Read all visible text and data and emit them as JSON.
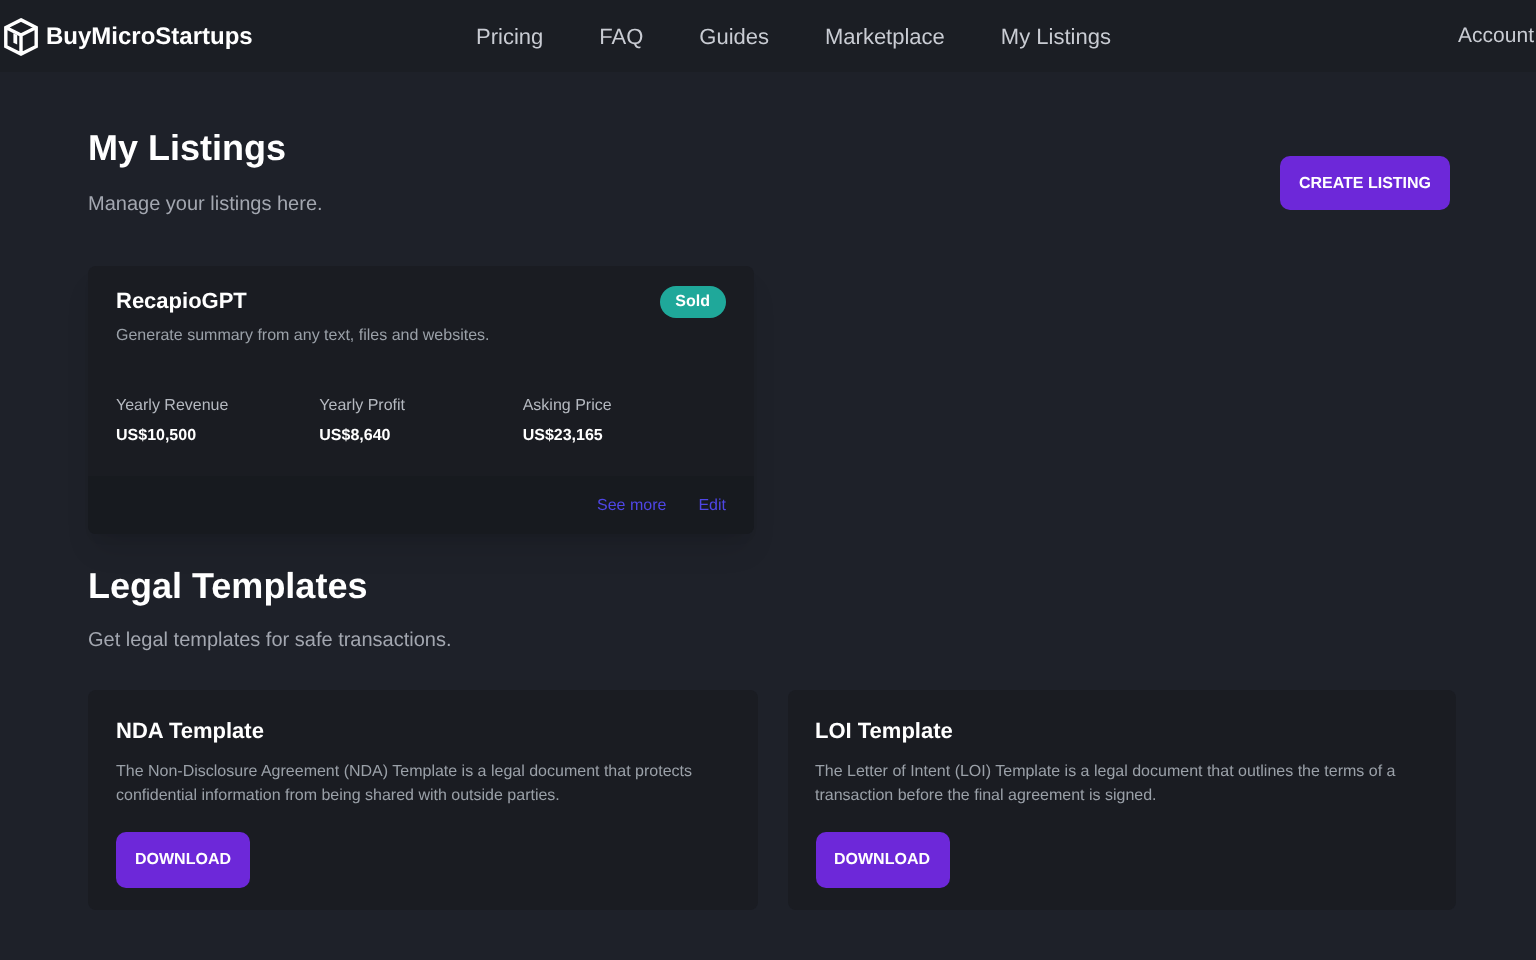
{
  "nav": {
    "brand": "BuyMicroStartups",
    "links": [
      "Pricing",
      "FAQ",
      "Guides",
      "Marketplace",
      "My Listings"
    ],
    "account": "Account"
  },
  "listings_section": {
    "title": "My Listings",
    "subtitle": "Manage your listings here.",
    "create_button": "CREATE LISTING",
    "listings": [
      {
        "name": "RecapioGPT",
        "description": "Generate summary from any text, files and websites.",
        "status": "Sold",
        "color": "#1fa89a",
        "metrics": [
          {
            "label": "Yearly Revenue",
            "value": "US$10,500"
          },
          {
            "label": "Yearly Profit",
            "value": "US$8,640"
          },
          {
            "label": "Asking Price",
            "value": "US$23,165"
          }
        ],
        "links": [
          "See more",
          "Edit"
        ]
      }
    ]
  },
  "templates_section": {
    "title": "Legal Templates",
    "subtitle": "Get legal templates for safe transactions.",
    "templates": [
      {
        "title": "NDA Template",
        "description": "The Non-Disclosure Agreement (NDA) Template is a legal document that protects confidential information from being shared with outside parties.",
        "button": "DOWNLOAD"
      },
      {
        "title": "LOI Template",
        "description": "The Letter of Intent (LOI) Template is a legal document that outlines the terms of a transaction before the final agreement is signed.",
        "button": "DOWNLOAD"
      }
    ]
  }
}
